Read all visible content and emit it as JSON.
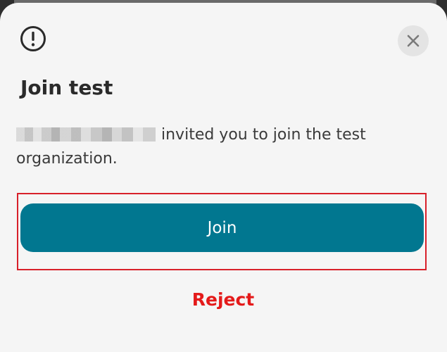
{
  "dialog": {
    "title": "Join test",
    "message": "invited you to join the test organization.",
    "join_label": "Join",
    "reject_label": "Reject"
  },
  "icons": {
    "alert": "alert-circle-icon",
    "close": "close-icon"
  },
  "colors": {
    "primary": "#017790",
    "danger": "#e41a1a",
    "highlight": "#d8202a",
    "sheet": "#f5f5f5"
  }
}
